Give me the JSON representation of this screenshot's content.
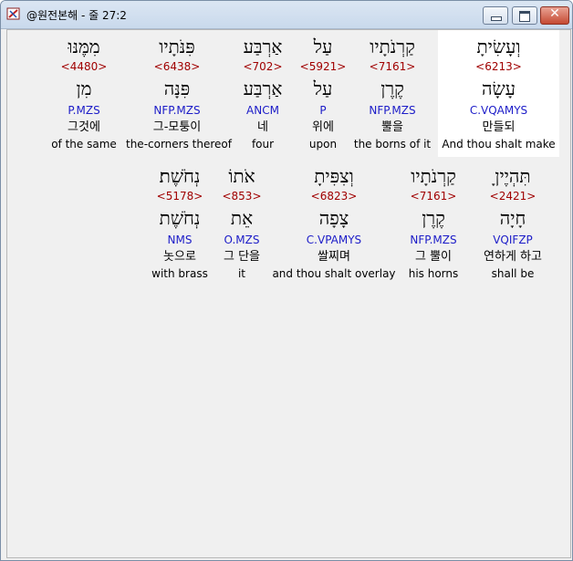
{
  "window": {
    "title": "@원전본해 - 줄 27:2",
    "close_glyph": "✕"
  },
  "row1": [
    {
      "heb": "וְעָשִׂיתָ",
      "num": "<6213>",
      "root": "עָשָׂה",
      "code": "C.VQAMYS",
      "kor": "만들되",
      "eng": "And thou shalt make",
      "highlighted": true
    },
    {
      "heb": "קַרְנֹתָיו",
      "num": "<7161>",
      "root": "קֶרֶן",
      "code": "NFP.MZS",
      "kor": "뿔을",
      "eng": "the borns of it"
    },
    {
      "heb": "עַל",
      "num": "<5921>",
      "root": "עַל",
      "code": "P",
      "kor": "위에",
      "eng": "upon"
    },
    {
      "heb": "אַרְבַּע",
      "num": "<702>",
      "root": "אַרְבַּע",
      "code": "ANCM",
      "kor": "네",
      "eng": "four"
    },
    {
      "heb": "פִּנֹּתָיו",
      "num": "<6438>",
      "root": "פִּנָּה",
      "code": "NFP.MZS",
      "kor": "그-모퉁이",
      "eng": "the-corners thereof"
    },
    {
      "heb": "מִמֶּנּוּ",
      "num": "<4480>",
      "root": "מִן",
      "code": "P.MZS",
      "kor": "그것에",
      "eng": "of the same"
    }
  ],
  "row2": [
    {
      "heb": "תִּהְיֶיןָ",
      "num": "<2421>",
      "root": "חָיָה",
      "code": "VQIFZP",
      "kor": "연하게 하고",
      "eng": "shall be"
    },
    {
      "heb": "קַרְנֹתָיו",
      "num": "<7161>",
      "root": "קֶרֶן",
      "code": "NFP.MZS",
      "kor": "그 뿔이",
      "eng": "his horns"
    },
    {
      "heb": "וְצִפִּיתָ",
      "num": "<6823>",
      "root": "צָפָה",
      "code": "C.VPAMYS",
      "kor": "쌀찌며",
      "eng": "and thou shalt overlay"
    },
    {
      "heb": "אֹתוֹ",
      "num": "<853>",
      "root": "אֵת",
      "code": "O.MZS",
      "kor": "그 단을",
      "eng": "it"
    },
    {
      "heb": "נְחֹשֶׁת׃",
      "num": "<5178>",
      "root": "נְחֹשֶׁת",
      "code": "NMS",
      "kor": "놋으로",
      "eng": "with brass"
    }
  ]
}
